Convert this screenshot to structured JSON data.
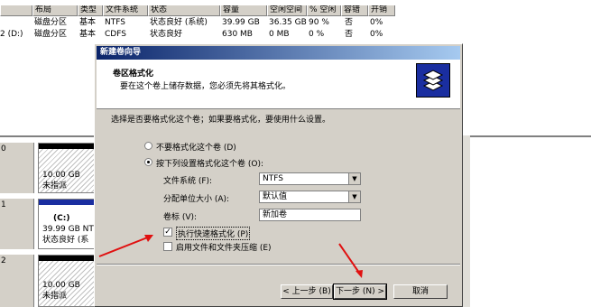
{
  "columns": [
    "布局",
    "类型",
    "文件系统",
    "状态",
    "容量",
    "空闲空间",
    "% 空闲",
    "容错",
    "开销"
  ],
  "rows": [
    [
      "",
      "磁盘分区",
      "基本",
      "NTFS",
      "状态良好 (系统)",
      "39.99 GB",
      "36.35 GB",
      "90 %",
      "否",
      "0%"
    ],
    [
      "2 (D:)",
      "磁盘分区",
      "基本",
      "CDFS",
      "状态良好",
      "630 MB",
      "0 MB",
      "0 %",
      "否",
      "0%"
    ]
  ],
  "disks": [
    {
      "label": "0",
      "part_size": "10.00 GB",
      "part_status": "未指派"
    },
    {
      "label": "1",
      "part_name": "(C:)",
      "part_size": "39.99 GB NTF",
      "part_status": "状态良好 (系"
    },
    {
      "label": "2",
      "part_size": "10.00 GB",
      "part_status": "未指派"
    }
  ],
  "wizard": {
    "title": "新建卷向导",
    "heading": "卷区格式化",
    "subheading": "要在这个卷上储存数据，您必须先将其格式化。",
    "prompt": "选择是否要格式化这个卷；如果要格式化，要使用什么设置。",
    "radio_no_format": "不要格式化这个卷 (D)",
    "radio_format": "按下列设置格式化这个卷 (O):",
    "fs_label": "文件系统 (F):",
    "fs_value": "NTFS",
    "alloc_label": "分配单位大小 (A):",
    "alloc_value": "默认值",
    "vol_label": "卷标 (V):",
    "vol_value": "新加卷",
    "quick_format": "执行快速格式化 (P)",
    "quick_format_checked": true,
    "compression": "启用文件和文件夹压缩 (E)",
    "compression_checked": false,
    "back_button": "< 上一步 (B)",
    "next_button": "下一步 (N) >",
    "cancel_button": "取消"
  },
  "colors": {
    "arrow": "#e01010",
    "titlebar": "#0a246a",
    "disk_bar_blue": "#1a2ea0"
  }
}
